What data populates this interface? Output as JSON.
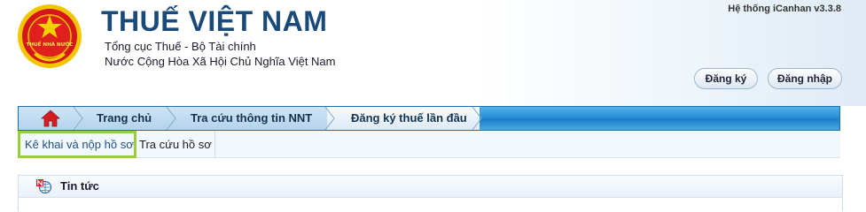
{
  "header": {
    "emblem_text": "THUẾ NHÀ NƯỚC",
    "title": "THUẾ VIỆT NAM",
    "subtitle_1": "Tổng cục Thuế - Bộ Tài chính",
    "subtitle_2": "Nước Cộng Hòa Xã Hội Chủ Nghĩa Việt Nam",
    "version": "Hệ thống iCanhan v3.3.8",
    "register_label": "Đăng ký",
    "login_label": "Đăng nhập"
  },
  "nav": {
    "home_icon": "home-icon",
    "items": [
      {
        "label": "Trang chủ"
      },
      {
        "label": "Tra cứu thông tin NNT"
      },
      {
        "label": "Đăng ký thuế lần đầu"
      }
    ]
  },
  "subnav": {
    "items": [
      {
        "label": "Kê khai và nộp hồ sơ"
      },
      {
        "label": "Tra cứu hồ sơ"
      }
    ]
  },
  "news": {
    "icon": "news-icon",
    "title": "Tin tức"
  },
  "colors": {
    "title": "#1a4a7a",
    "nav_blue": "#2b90d8",
    "highlight_border": "#9ccc3a"
  }
}
